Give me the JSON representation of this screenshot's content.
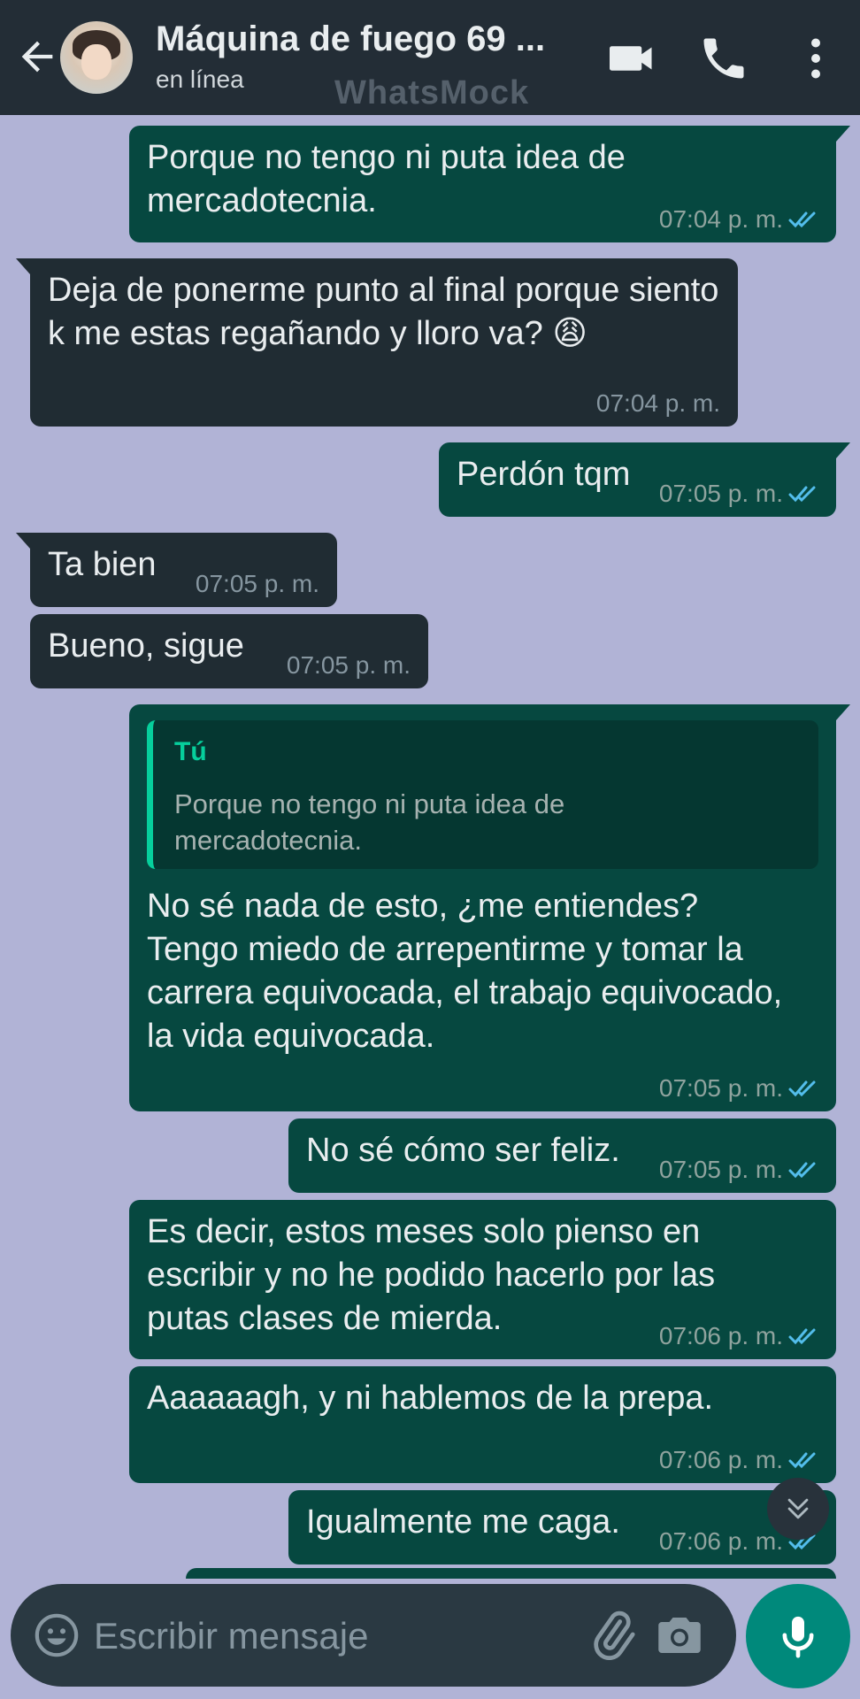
{
  "header": {
    "contact_name": "Máquina de fuego 69 ...",
    "status": "en línea",
    "watermark": "WhatsMock"
  },
  "colors": {
    "wallpaper": "#b1b3d6",
    "outgoing_bubble": "#064840",
    "incoming_bubble": "#202c33",
    "read_tick": "#53bdeb",
    "send_button": "#00897b"
  },
  "messages": [
    {
      "direction": "out",
      "text": "Porque no tengo ni puta idea de mercadotecnia.",
      "time": "07:04 p. m.",
      "status": "read"
    },
    {
      "direction": "in",
      "text": "Deja de ponerme punto al final porque siento k me estas regañando y lloro va? 😩",
      "time": "07:04 p. m."
    },
    {
      "direction": "out",
      "text": "Perdón tqm",
      "time": "07:05 p. m.",
      "status": "read"
    },
    {
      "direction": "in",
      "text": "Ta bien",
      "time": "07:05 p. m."
    },
    {
      "direction": "in",
      "text": "Bueno, sigue",
      "time": "07:05 p. m."
    },
    {
      "direction": "out",
      "quote": {
        "author": "Tú",
        "text": "Porque no tengo ni puta idea de mercadotecnia."
      },
      "text": "No sé nada de esto, ¿me entiendes? Tengo miedo de arrepentirme y tomar la carrera equivocada, el trabajo equivocado, la vida equivocada.",
      "time": "07:05 p. m.",
      "status": "read"
    },
    {
      "direction": "out",
      "text": "No sé cómo ser feliz.",
      "time": "07:05 p. m.",
      "status": "read"
    },
    {
      "direction": "out",
      "text": "Es decir, estos meses solo pienso en escribir y no he podido hacerlo por las putas clases de mierda.",
      "time": "07:06 p. m.",
      "status": "read"
    },
    {
      "direction": "out",
      "text": "Aaaaaagh, y ni hablemos de la prepa.",
      "time": "07:06 p. m.",
      "status": "read"
    },
    {
      "direction": "out",
      "text": "Igualmente me caga.",
      "time": "07:06 p. m.",
      "status": "read"
    }
  ],
  "composer": {
    "placeholder": "Escribir mensaje"
  }
}
